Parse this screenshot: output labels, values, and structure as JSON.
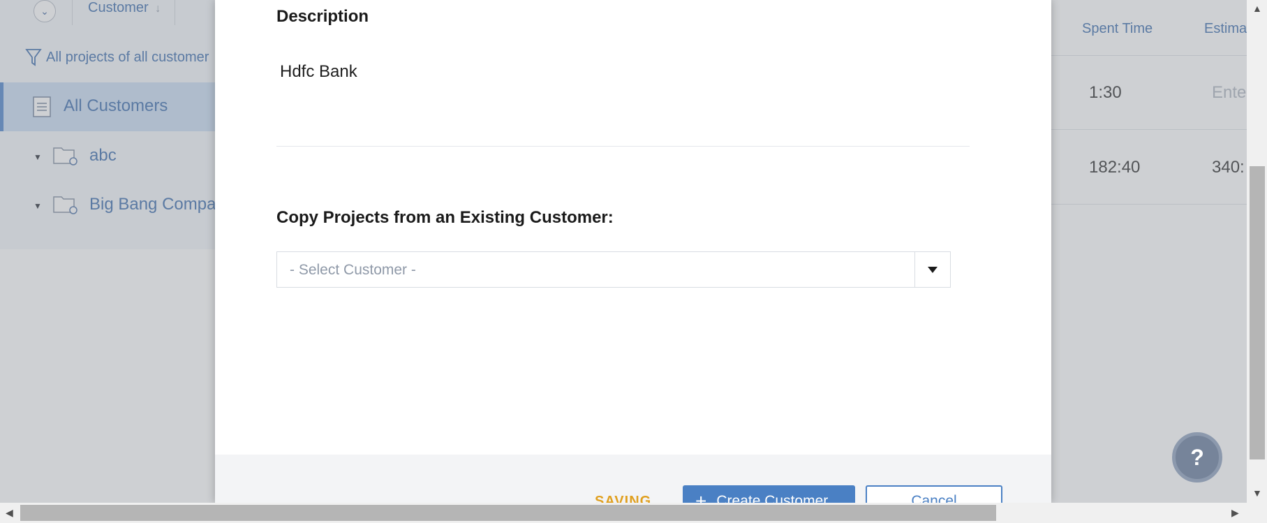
{
  "background": {
    "column_customer": "Customer",
    "filter_text": "All projects of all customer",
    "tree": {
      "all_customers": "All Customers",
      "items": [
        "abc",
        "Big Bang Compa"
      ]
    },
    "table": {
      "headers": [
        "Spent Time",
        "Estima"
      ],
      "rows": [
        {
          "spent": "1:30",
          "estimate": "Ente"
        },
        {
          "spent": "182:40",
          "estimate": "340:"
        }
      ]
    }
  },
  "modal": {
    "description_label": "Description",
    "description_value": "Hdfc Bank",
    "copy_label": "Copy Projects from an Existing Customer:",
    "select_placeholder": "- Select Customer -",
    "footer": {
      "status": "SAVING",
      "create_button": "Create Customer",
      "cancel_button": "Cancel"
    }
  },
  "help": {
    "label": "?"
  },
  "colors": {
    "accent": "#4a80c4",
    "saving": "#e0a020",
    "link": "#4b79b5"
  }
}
